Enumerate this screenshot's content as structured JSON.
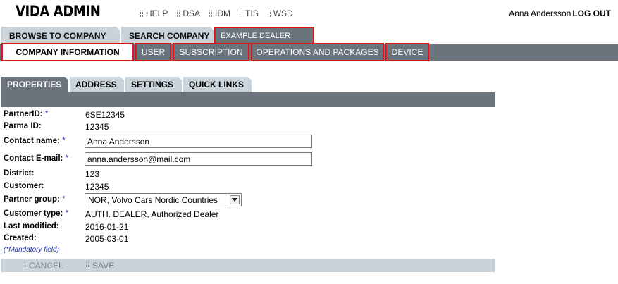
{
  "app": {
    "title": "VIDA ADMIN"
  },
  "top_links": [
    "HELP",
    "DSA",
    "IDM",
    "TIS",
    "WSD"
  ],
  "user": {
    "name": "Anna Andersson",
    "logout": "LOG OUT"
  },
  "main_tabs": [
    {
      "label": "BROWSE TO COMPANY"
    },
    {
      "label": "SEARCH COMPANY"
    },
    {
      "label": "EXAMPLE DEALER"
    }
  ],
  "section_tabs": [
    {
      "label": "COMPANY INFORMATION"
    },
    {
      "label": "USER"
    },
    {
      "label": "SUBSCRIPTION"
    },
    {
      "label": "OPERATIONS AND PACKAGES"
    },
    {
      "label": "DEVICE"
    }
  ],
  "sub_tabs": [
    {
      "label": "PROPERTIES"
    },
    {
      "label": "ADDRESS"
    },
    {
      "label": "SETTINGS"
    },
    {
      "label": "QUICK LINKS"
    }
  ],
  "form": {
    "partner_id": {
      "label": "PartnerID:",
      "req": "*",
      "value": "6SE12345"
    },
    "parma_id": {
      "label": "Parma ID:",
      "value": "12345"
    },
    "contact_name": {
      "label": "Contact name:",
      "req": "*",
      "value": "Anna Andersson"
    },
    "contact_email": {
      "label": "Contact E-mail:",
      "req": "*",
      "value": "anna.andersson@mail.com"
    },
    "district": {
      "label": "District:",
      "value": "123"
    },
    "customer": {
      "label": "Customer:",
      "value": "12345"
    },
    "partner_group": {
      "label": "Partner group:",
      "req": "*",
      "value": "NOR, Volvo Cars Nordic Countries"
    },
    "customer_type": {
      "label": "Customer type:",
      "req": "*",
      "value": "AUTH. DEALER, Authorized Dealer"
    },
    "last_modified": {
      "label": "Last modified:",
      "value": "2016-01-21"
    },
    "created": {
      "label": "Created:",
      "value": "2005-03-01"
    },
    "mandatory_note": "(*Mandatory field)"
  },
  "actions": {
    "cancel": "CANCEL",
    "save": "SAVE"
  },
  "colors": {
    "tab_bg": "#c9d3d9",
    "dark_bar": "#6b747c",
    "highlight_border": "#e0141e",
    "required": "#2233aa"
  }
}
